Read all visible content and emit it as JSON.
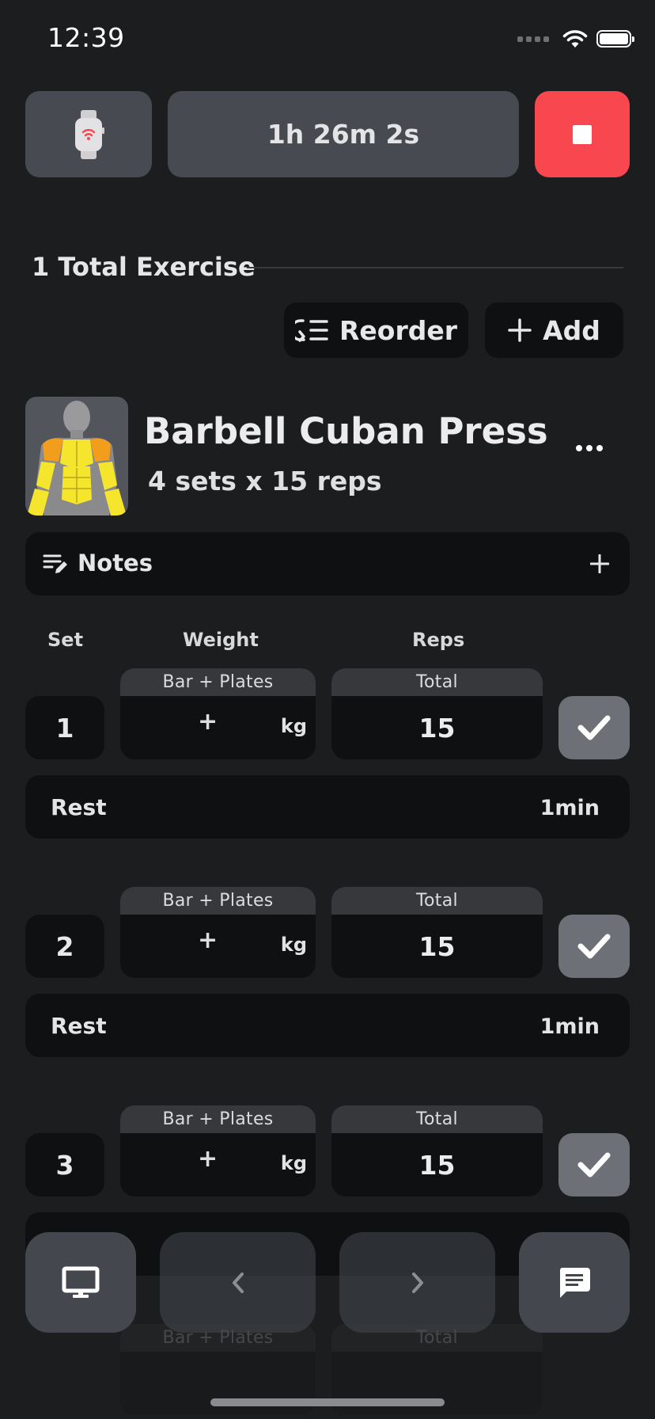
{
  "status_bar": {
    "time": "12:39"
  },
  "header": {
    "timer": "1h 26m 2s"
  },
  "section": {
    "title": "1 Total Exercise"
  },
  "actions": {
    "reorder_label": "Reorder",
    "add_label": "Add"
  },
  "exercise": {
    "name": "Barbell Cuban Press",
    "summary": "4 sets x 15 reps"
  },
  "notes": {
    "label": "Notes"
  },
  "table": {
    "col_set": "Set",
    "col_weight": "Weight",
    "col_reps": "Reps"
  },
  "sets": [
    {
      "number": "1",
      "weight_header": "Bar + Plates",
      "weight_plus": "+",
      "unit": "kg",
      "reps_header": "Total",
      "reps": "15",
      "rest_label": "Rest",
      "rest_value": "1min"
    },
    {
      "number": "2",
      "weight_header": "Bar + Plates",
      "weight_plus": "+",
      "unit": "kg",
      "reps_header": "Total",
      "reps": "15",
      "rest_label": "Rest",
      "rest_value": "1min"
    },
    {
      "number": "3",
      "weight_header": "Bar + Plates",
      "weight_plus": "+",
      "unit": "kg",
      "reps_header": "Total",
      "reps": "15"
    },
    {
      "weight_header": "Bar + Plates",
      "reps_header": "Total"
    }
  ],
  "colors": {
    "stop": "#f8474f",
    "card": "#0f1012",
    "button": "#474a51",
    "muscle_primary": "#f5e52c",
    "muscle_secondary": "#f29d1c"
  },
  "icons": {
    "watch": "watch-icon",
    "stop": "stop-icon",
    "reorder": "reorder-icon",
    "add": "plus-icon",
    "more": "more-icon",
    "notes": "notes-edit-icon",
    "check": "checkmark-icon",
    "screen": "monitor-icon",
    "prev": "chevron-left-icon",
    "next": "chevron-right-icon",
    "chat": "chat-icon"
  }
}
